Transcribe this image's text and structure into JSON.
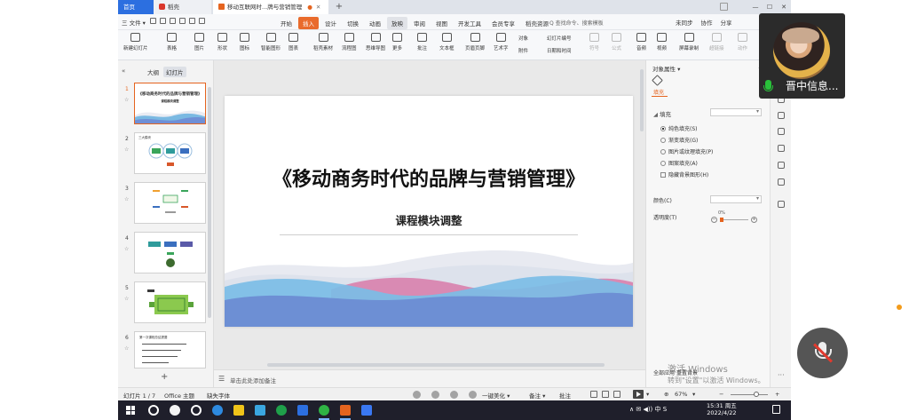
{
  "tabs": {
    "home": "首页",
    "draft": "稻壳",
    "doc": "移动互联网时...牌与营销管理",
    "add": "+"
  },
  "menubar": {
    "file": "三 文件 ▾",
    "items": [
      "开始",
      "插入",
      "设计",
      "切换",
      "动画",
      "放映",
      "审阅",
      "视图",
      "开发工具",
      "会员专享",
      "稻壳资源"
    ],
    "active_index": 1,
    "hover_index": 5,
    "search": "Q 查找命令、搜索模板",
    "sync": "未同步",
    "collab": "协作",
    "share": "分享"
  },
  "ribbon": {
    "items": [
      "新建幻灯片",
      "表格",
      "图片",
      "形状",
      "图标",
      "智能图形",
      "图表",
      "稻壳素材",
      "流程图",
      "思维导图",
      "更多",
      "批注",
      "文本框",
      "页眉页脚",
      "艺术字",
      "符号",
      "公式",
      "音频",
      "视频",
      "屏幕录制",
      "超链接",
      "动作"
    ],
    "small_items": [
      "对象",
      "附件",
      "幻灯片编号",
      "日期和时间"
    ]
  },
  "left_panel": {
    "tab_outline": "大纲",
    "tab_slides": "幻灯片",
    "thumbs": [
      {
        "num": "1"
      },
      {
        "num": "2"
      },
      {
        "num": "3"
      },
      {
        "num": "4"
      },
      {
        "num": "5"
      },
      {
        "num": "6"
      }
    ],
    "thumb1_title": "《移动商务时代的品牌与营销管理》",
    "thumb1_sub": "课程模块调整",
    "thumb2_title": "三大模块",
    "thumb6_title": "第一次课程总结提要",
    "add": "+"
  },
  "slide": {
    "title": "《移动商务时代的品牌与营销管理》",
    "subtitle": "课程模块调整"
  },
  "notes_placeholder": "单击此处添加备注",
  "right_panel": {
    "title": "对象属性 ▾",
    "fill_tab": "填充",
    "section": "填充",
    "options": [
      "纯色填充(S)",
      "渐变填充(G)",
      "图片或纹理填充(P)",
      "图案填充(A)"
    ],
    "checkbox": "隐藏背景图形(H)",
    "color_label": "颜色(C)",
    "transparency_label": "透明度(T)",
    "transparency_value": "0%",
    "apply_all": "全部应用",
    "reset": "重置背景"
  },
  "statusbar": {
    "slide_count": "幻灯片 1 / 7",
    "theme": "Office 主题",
    "missing_font": "缺失字体",
    "beautify": "一键美化 ▾",
    "notes": "备注 ▾",
    "comments": "批注",
    "zoom": "67%"
  },
  "overlays": {
    "participant_name": "晋中信息...",
    "watermark_line1": "激活 Windows",
    "watermark_line2": "转到\"设置\"以激活 Windows。"
  },
  "taskbar": {
    "tray": "∧ ✉ ◀)) 中 S",
    "time": "15:31 周五",
    "date": "2022/4/22"
  }
}
